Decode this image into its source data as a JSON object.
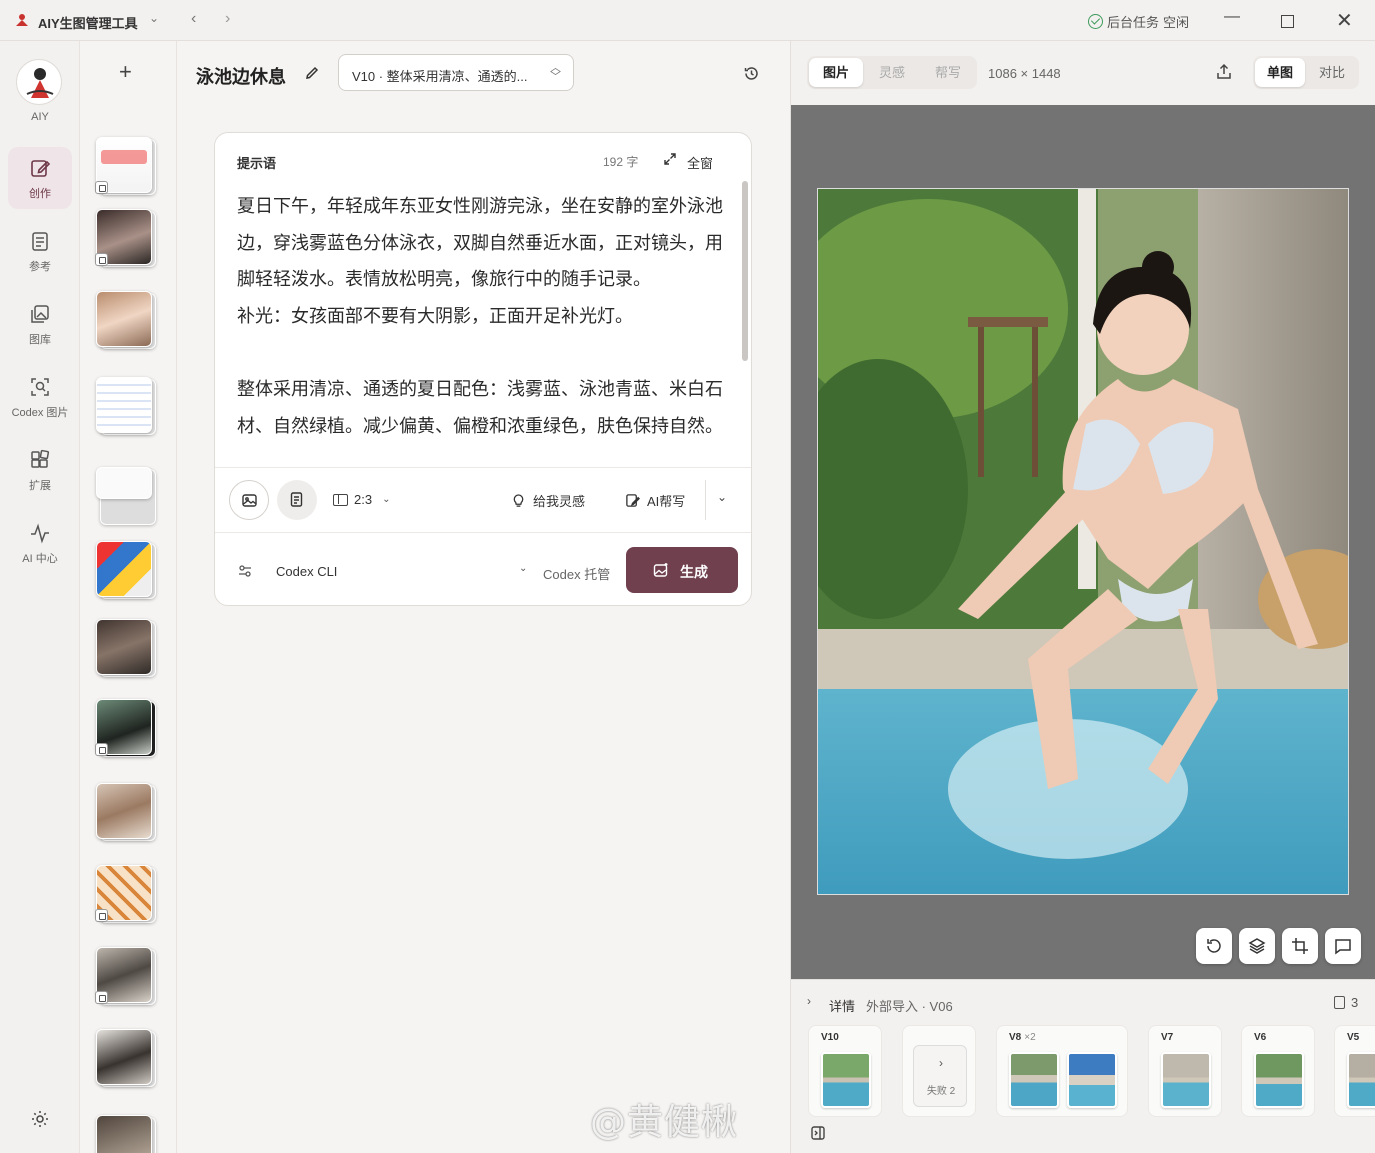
{
  "titlebar": {
    "app_title": "AIY生图管理工具",
    "bg_task_label": "后台任务",
    "bg_task_status": "空闲"
  },
  "rail": {
    "logo_label": "AIY",
    "items": [
      {
        "label": "创作",
        "icon": "edit-icon",
        "active": true
      },
      {
        "label": "参考",
        "icon": "document-icon"
      },
      {
        "label": "图库",
        "icon": "gallery-icon"
      },
      {
        "label": "Codex 图片",
        "icon": "image-search-icon"
      },
      {
        "label": "扩展",
        "icon": "extensions-icon"
      },
      {
        "label": "AI 中心",
        "icon": "activity-icon"
      }
    ]
  },
  "editor": {
    "title": "泳池边休息",
    "version_select": "V10 · 整体采用清凉、通透的...",
    "prompt": {
      "label": "提示语",
      "char_count": "192 字",
      "expand_label": "全窗",
      "text": "夏日下午，年轻成年东亚女性刚游完泳，坐在安静的室外泳池边，穿浅雾蓝色分体泳衣，双脚自然垂近水面，正对镜头，用脚轻轻泼水。表情放松明亮，像旅行中的随手记录。\n补光：女孩面部不要有大阴影，正面开足补光灯。\n\n整体采用清凉、通透的夏日配色：浅雾蓝、泳池青蓝、米白石材、自然绿植。减少偏黄、偏橙和浓重绿色，肤色保持自然。"
    },
    "toolbar": {
      "ratio": "2:3",
      "idea": "给我灵感",
      "ai_write": "AI帮写"
    },
    "bottom": {
      "engine": "Codex CLI",
      "host": "Codex 托管",
      "generate": "生成"
    }
  },
  "viewer": {
    "tabs": [
      "图片",
      "灵感",
      "帮写"
    ],
    "dimensions": "1086 × 1448",
    "modes": [
      "单图",
      "对比"
    ],
    "details": {
      "label": "详情",
      "source": "外部导入 · V06",
      "count": "3"
    },
    "versions": [
      {
        "label": "V10",
        "suffix": ""
      },
      {
        "label": "V8",
        "suffix": "×2"
      },
      {
        "label": "V7",
        "suffix": ""
      },
      {
        "label": "V6",
        "suffix": ""
      },
      {
        "label": "V5",
        "suffix": ""
      }
    ],
    "failed": "失败 2"
  },
  "watermark": "@黄健楸"
}
